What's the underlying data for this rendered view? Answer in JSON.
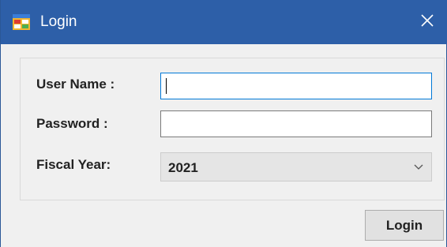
{
  "window": {
    "title": "Login",
    "close_glyph": "✕",
    "app_icon": "form-app-icon",
    "close_icon": "close-icon"
  },
  "form": {
    "username_label": "User Name :",
    "username_value": "",
    "password_label": "Password :",
    "password_value": "",
    "fiscal_year_label": "Fiscal Year:",
    "fiscal_year_value": "2021",
    "dropdown_icon": "chevron-down-icon"
  },
  "actions": {
    "login_label": "Login"
  },
  "colors": {
    "titlebar": "#2d5fa8",
    "window_bg": "#f0f0f0",
    "focus_border": "#0078d7"
  }
}
